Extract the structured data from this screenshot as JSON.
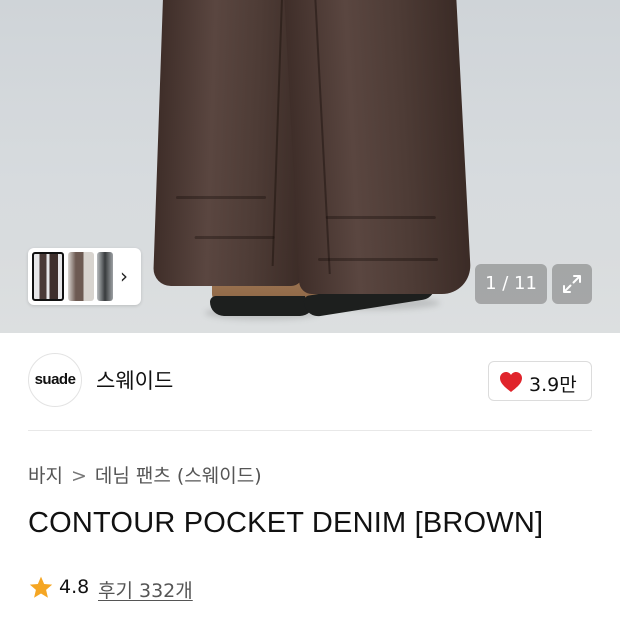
{
  "gallery": {
    "counter_text": "1 / 11",
    "expand_icon": "expand-icon",
    "thumbnail_next_icon": "chevron-right-icon"
  },
  "brand": {
    "logo_text": "suade",
    "name": "스웨이드",
    "likes": "3.9만",
    "like_color": "#e0242b"
  },
  "breadcrumb": {
    "items": [
      "바지",
      "데님 팬츠 (스웨이드)"
    ],
    "separator": ">"
  },
  "product": {
    "title": "CONTOUR POCKET DENIM [BROWN]",
    "rating": "4.8",
    "reviews_label": "후기 332개",
    "star_color": "#f5a623"
  }
}
